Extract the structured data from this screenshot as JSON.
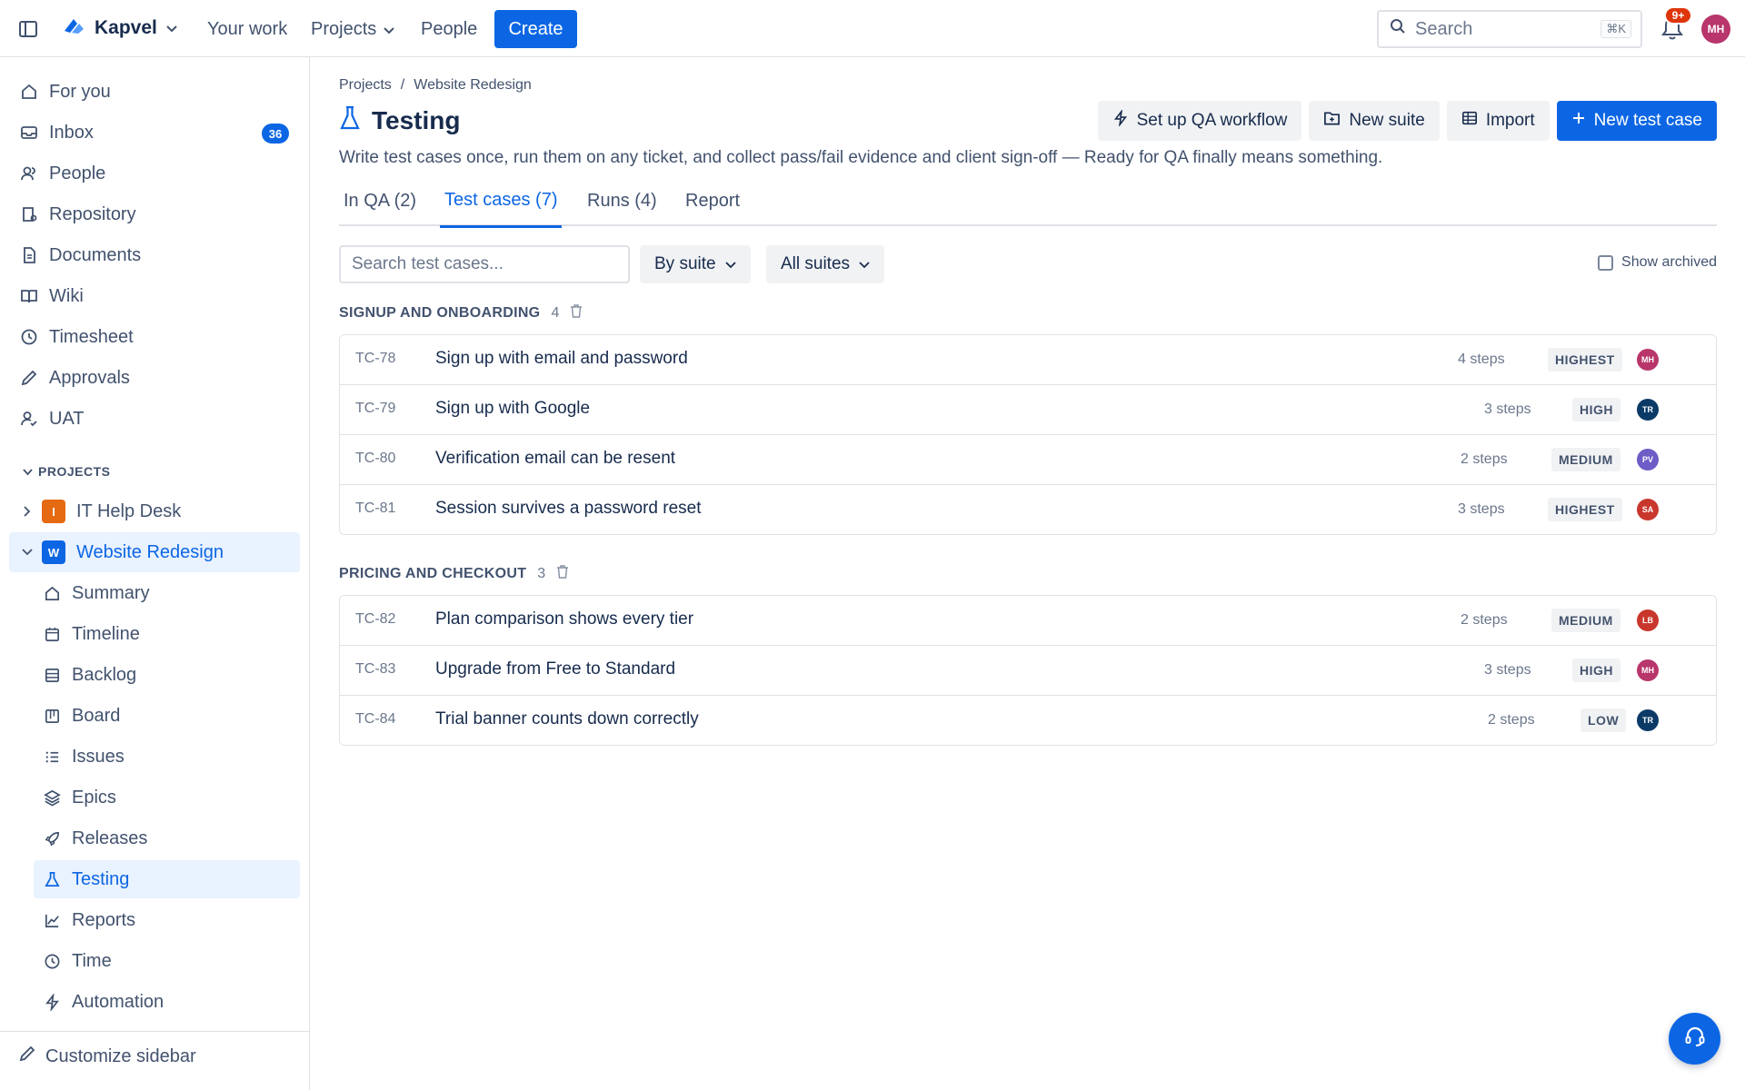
{
  "header": {
    "brand": "Kapvel",
    "nav": {
      "your_work": "Your work",
      "projects": "Projects",
      "people": "People"
    },
    "create_label": "Create",
    "search_placeholder": "Search",
    "search_shortcut": "⌘K",
    "notification_badge": "9+",
    "user_initials": "MH"
  },
  "sidebar": {
    "items": [
      {
        "label": "For you",
        "icon": "home-icon"
      },
      {
        "label": "Inbox",
        "icon": "inbox-icon",
        "badge": "36"
      },
      {
        "label": "People",
        "icon": "people-icon"
      },
      {
        "label": "Repository",
        "icon": "repository-icon"
      },
      {
        "label": "Documents",
        "icon": "document-icon"
      },
      {
        "label": "Wiki",
        "icon": "book-icon"
      },
      {
        "label": "Timesheet",
        "icon": "clock-icon"
      },
      {
        "label": "Approvals",
        "icon": "pen-icon"
      },
      {
        "label": "UAT",
        "icon": "user-check-icon"
      }
    ],
    "projects_heading": "PROJECTS",
    "projects": [
      {
        "label": "IT Help Desk",
        "key": "I",
        "color": "#e56910",
        "expanded": false
      },
      {
        "label": "Website Redesign",
        "key": "W",
        "color": "#0c66e4",
        "expanded": true
      }
    ],
    "sub_items": [
      {
        "label": "Summary",
        "icon": "home-icon"
      },
      {
        "label": "Timeline",
        "icon": "calendar-icon"
      },
      {
        "label": "Backlog",
        "icon": "backlog-icon"
      },
      {
        "label": "Board",
        "icon": "board-icon"
      },
      {
        "label": "Issues",
        "icon": "list-icon"
      },
      {
        "label": "Epics",
        "icon": "layers-icon"
      },
      {
        "label": "Releases",
        "icon": "rocket-icon"
      },
      {
        "label": "Testing",
        "icon": "flask-icon",
        "active": true
      },
      {
        "label": "Reports",
        "icon": "chart-icon"
      },
      {
        "label": "Time",
        "icon": "clock-icon"
      },
      {
        "label": "Automation",
        "icon": "bolt-icon"
      }
    ],
    "customize_label": "Customize sidebar"
  },
  "main": {
    "breadcrumb": [
      "Projects",
      "Website Redesign"
    ],
    "title": "Testing",
    "actions": {
      "qa_workflow": "Set up QA workflow",
      "new_suite": "New suite",
      "import": "Import",
      "new_test_case": "New test case"
    },
    "description": "Write test cases once, run them on any ticket, and collect pass/fail evidence and client sign-off — Ready for QA finally means something.",
    "tabs": [
      {
        "label": "In QA (2)",
        "active": false
      },
      {
        "label": "Test cases (7)",
        "active": true
      },
      {
        "label": "Runs (4)",
        "active": false
      },
      {
        "label": "Report",
        "active": false
      }
    ],
    "search_placeholder": "Search test cases...",
    "group_by": "By suite",
    "suite_filter": "All suites",
    "show_archived": "Show archived",
    "suites": [
      {
        "name": "SIGNUP AND ONBOARDING",
        "count": "4",
        "cases": [
          {
            "id": "TC-78",
            "title": "Sign up with email and password",
            "steps": "4 steps",
            "priority": "HIGHEST",
            "assignee": "MH",
            "color": "#b8366b"
          },
          {
            "id": "TC-79",
            "title": "Sign up with Google",
            "steps": "3 steps",
            "priority": "HIGH",
            "assignee": "TR",
            "color": "#0b3a66"
          },
          {
            "id": "TC-80",
            "title": "Verification email can be resent",
            "steps": "2 steps",
            "priority": "MEDIUM",
            "assignee": "PV",
            "color": "#6e5dc6"
          },
          {
            "id": "TC-81",
            "title": "Session survives a password reset",
            "steps": "3 steps",
            "priority": "HIGHEST",
            "assignee": "SA",
            "color": "#c9372c"
          }
        ]
      },
      {
        "name": "PRICING AND CHECKOUT",
        "count": "3",
        "cases": [
          {
            "id": "TC-82",
            "title": "Plan comparison shows every tier",
            "steps": "2 steps",
            "priority": "MEDIUM",
            "assignee": "LB",
            "color": "#c9372c"
          },
          {
            "id": "TC-83",
            "title": "Upgrade from Free to Standard",
            "steps": "3 steps",
            "priority": "HIGH",
            "assignee": "MH",
            "color": "#b8366b"
          },
          {
            "id": "TC-84",
            "title": "Trial banner counts down correctly",
            "steps": "2 steps",
            "priority": "LOW",
            "assignee": "TR",
            "color": "#0b3a66"
          }
        ]
      }
    ]
  },
  "colors": {
    "accent": "#0c66e4",
    "badge_red": "#de350b"
  }
}
